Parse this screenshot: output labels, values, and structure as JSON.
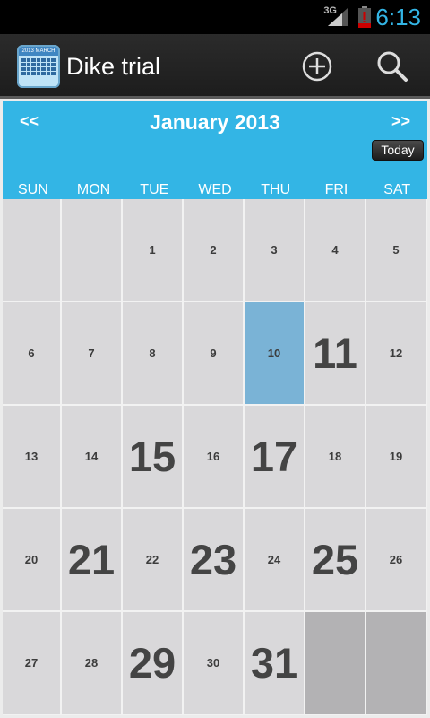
{
  "status_bar": {
    "network": "3G",
    "time": "6:13"
  },
  "action_bar": {
    "title": "Dike trial",
    "app_icon": "calendar-app-icon",
    "app_icon_text": "2013 MARCH",
    "actions": [
      {
        "icon": "add-circle-icon"
      },
      {
        "icon": "search-icon"
      }
    ]
  },
  "calendar": {
    "prev_label": "<<",
    "next_label": ">>",
    "month_title": "January 2013",
    "today_label": "Today",
    "weekdays": [
      "SUN",
      "MON",
      "TUE",
      "WED",
      "THU",
      "FRI",
      "SAT"
    ],
    "accent_color": "#33b5e5",
    "selected_color": "#7ab3d6",
    "weeks": [
      [
        {
          "day": "",
          "style": "empty"
        },
        {
          "day": "",
          "style": "empty"
        },
        {
          "day": "1",
          "style": "normal"
        },
        {
          "day": "2",
          "style": "normal"
        },
        {
          "day": "3",
          "style": "normal"
        },
        {
          "day": "4",
          "style": "normal"
        },
        {
          "day": "5",
          "style": "normal"
        }
      ],
      [
        {
          "day": "6",
          "style": "normal"
        },
        {
          "day": "7",
          "style": "normal"
        },
        {
          "day": "8",
          "style": "normal"
        },
        {
          "day": "9",
          "style": "normal"
        },
        {
          "day": "10",
          "style": "today"
        },
        {
          "day": "11",
          "style": "big"
        },
        {
          "day": "12",
          "style": "normal"
        }
      ],
      [
        {
          "day": "13",
          "style": "normal"
        },
        {
          "day": "14",
          "style": "normal"
        },
        {
          "day": "15",
          "style": "big"
        },
        {
          "day": "16",
          "style": "normal"
        },
        {
          "day": "17",
          "style": "big"
        },
        {
          "day": "18",
          "style": "normal"
        },
        {
          "day": "19",
          "style": "normal"
        }
      ],
      [
        {
          "day": "20",
          "style": "normal"
        },
        {
          "day": "21",
          "style": "big"
        },
        {
          "day": "22",
          "style": "normal"
        },
        {
          "day": "23",
          "style": "big"
        },
        {
          "day": "24",
          "style": "normal"
        },
        {
          "day": "25",
          "style": "big"
        },
        {
          "day": "26",
          "style": "normal"
        }
      ],
      [
        {
          "day": "27",
          "style": "normal"
        },
        {
          "day": "28",
          "style": "normal"
        },
        {
          "day": "29",
          "style": "big"
        },
        {
          "day": "30",
          "style": "normal"
        },
        {
          "day": "31",
          "style": "big"
        },
        {
          "day": "",
          "style": "empty-dark"
        },
        {
          "day": "",
          "style": "empty-dark"
        }
      ]
    ]
  }
}
